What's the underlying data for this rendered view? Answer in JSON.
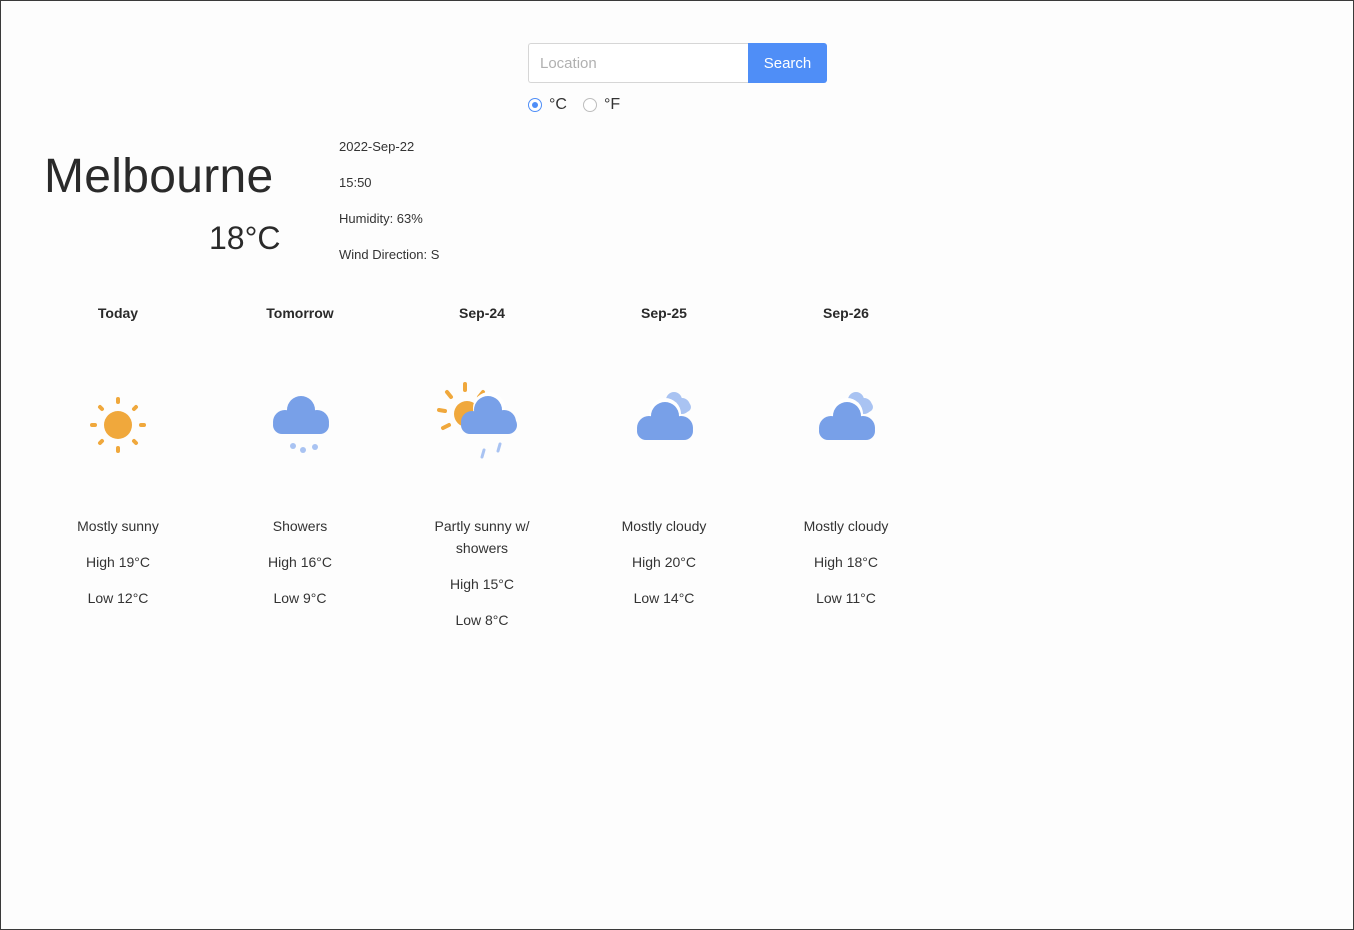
{
  "search": {
    "placeholder": "Location",
    "button_label": "Search"
  },
  "units": {
    "celsius_label": "°C",
    "fahrenheit_label": "°F",
    "selected": "celsius"
  },
  "current": {
    "city": "Melbourne",
    "temperature": "18°C",
    "date": "2022-Sep-22",
    "time": "15:50",
    "humidity": "Humidity: 63%",
    "wind": "Wind Direction: S"
  },
  "forecast": [
    {
      "day": "Today",
      "icon": "sunny-icon",
      "desc": "Mostly sunny",
      "high": "High 19°C",
      "low": "Low 12°C"
    },
    {
      "day": "Tomorrow",
      "icon": "showers-icon",
      "desc": "Showers",
      "high": "High 16°C",
      "low": "Low 9°C"
    },
    {
      "day": "Sep-24",
      "icon": "partly-sunny-showers-icon",
      "desc": "Partly sunny w/ showers",
      "high": "High 15°C",
      "low": "Low 8°C"
    },
    {
      "day": "Sep-25",
      "icon": "mostly-cloudy-icon",
      "desc": "Mostly cloudy",
      "high": "High 20°C",
      "low": "Low 14°C"
    },
    {
      "day": "Sep-26",
      "icon": "mostly-cloudy-icon",
      "desc": "Mostly cloudy",
      "high": "High 18°C",
      "low": "Low 11°C"
    }
  ],
  "colors": {
    "accent": "#4f8ef7",
    "sun": "#f0a83c",
    "cloud": "#78a0e8",
    "cloud_light": "#a9c3f2"
  }
}
